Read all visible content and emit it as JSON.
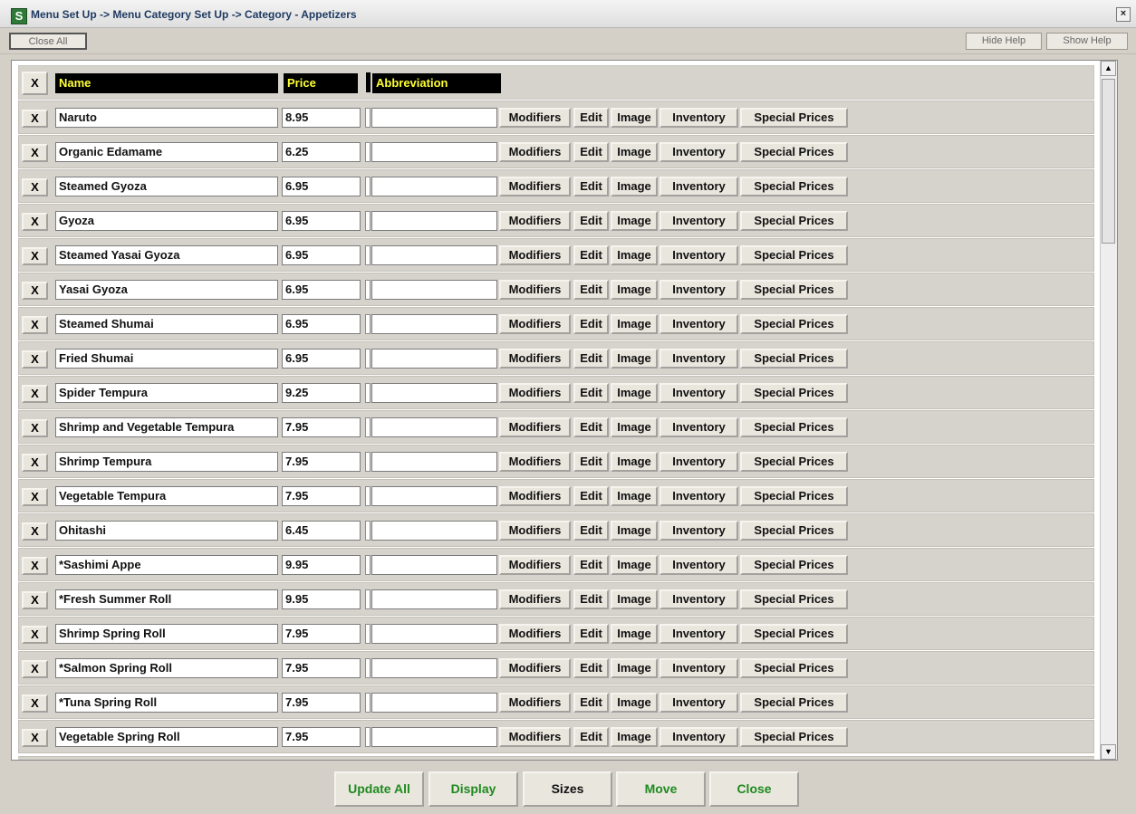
{
  "window": {
    "title": "Menu Set Up -> Menu Category Set Up -> Category - Appetizers",
    "icon_glyph": "S",
    "close_glyph": "×"
  },
  "toolbar": {
    "close_all": "Close All",
    "hide_help": "Hide Help",
    "show_help": "Show Help"
  },
  "table": {
    "headers": {
      "x": "X",
      "name": "Name",
      "price": "Price",
      "abbreviation": "Abbreviation"
    },
    "row_x": "X",
    "actions": {
      "modifiers": "Modifiers",
      "edit": "Edit",
      "image": "Image",
      "inventory": "Inventory",
      "special_prices": "Special Prices"
    },
    "rows": [
      {
        "name": "Naruto",
        "price": "8.95",
        "abbreviation": ""
      },
      {
        "name": "Organic Edamame",
        "price": "6.25",
        "abbreviation": ""
      },
      {
        "name": "Steamed Gyoza",
        "price": "6.95",
        "abbreviation": ""
      },
      {
        "name": "Gyoza",
        "price": "6.95",
        "abbreviation": ""
      },
      {
        "name": "Steamed Yasai Gyoza",
        "price": "6.95",
        "abbreviation": ""
      },
      {
        "name": "Yasai Gyoza",
        "price": "6.95",
        "abbreviation": ""
      },
      {
        "name": "Steamed Shumai",
        "price": "6.95",
        "abbreviation": ""
      },
      {
        "name": "Fried Shumai",
        "price": "6.95",
        "abbreviation": ""
      },
      {
        "name": "Spider Tempura",
        "price": "9.25",
        "abbreviation": ""
      },
      {
        "name": "Shrimp and Vegetable Tempura",
        "price": "7.95",
        "abbreviation": ""
      },
      {
        "name": "Shrimp Tempura",
        "price": "7.95",
        "abbreviation": ""
      },
      {
        "name": "Vegetable Tempura",
        "price": "7.95",
        "abbreviation": ""
      },
      {
        "name": "Ohitashi",
        "price": "6.45",
        "abbreviation": ""
      },
      {
        "name": "*Sashimi Appe",
        "price": "9.95",
        "abbreviation": ""
      },
      {
        "name": "*Fresh Summer Roll",
        "price": "9.95",
        "abbreviation": ""
      },
      {
        "name": "Shrimp Spring Roll",
        "price": "7.95",
        "abbreviation": ""
      },
      {
        "name": "*Salmon Spring Roll",
        "price": "7.95",
        "abbreviation": ""
      },
      {
        "name": "*Tuna Spring Roll",
        "price": "7.95",
        "abbreviation": ""
      },
      {
        "name": "Vegetable Spring Roll",
        "price": "7.95",
        "abbreviation": ""
      }
    ]
  },
  "footer": {
    "update_all": "Update All",
    "display": "Display",
    "sizes": "Sizes",
    "move": "Move",
    "close": "Close"
  },
  "colors": {
    "header_bg": "#000000",
    "header_text": "#ffff33",
    "footer_green": "#1e8a1e",
    "title_text": "#1f3b62"
  },
  "scrollbar": {
    "up_glyph": "▲",
    "down_glyph": "▼"
  }
}
